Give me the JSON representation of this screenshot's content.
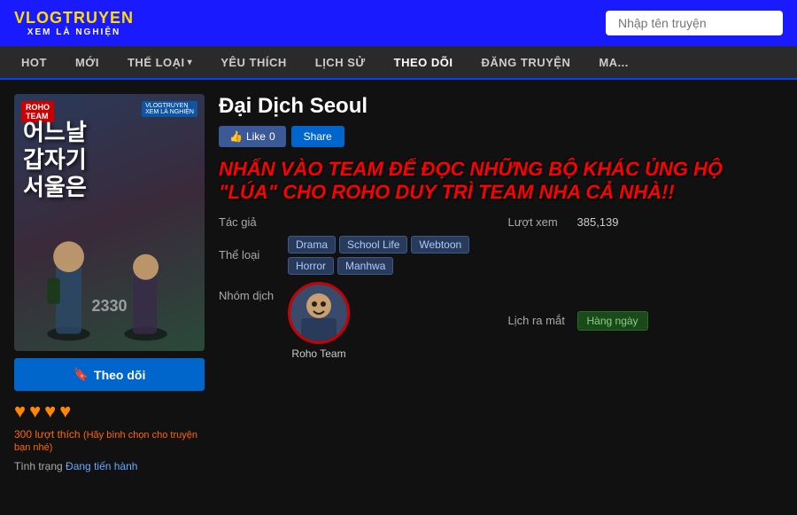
{
  "header": {
    "logo_top": "VLOGTRUYEN",
    "logo_sub": "XEM LÀ NGHIỆN",
    "search_placeholder": "Nhập tên truyện"
  },
  "nav": {
    "items": [
      {
        "label": "HOT",
        "has_arrow": false
      },
      {
        "label": "MỚI",
        "has_arrow": false
      },
      {
        "label": "THỂ LOẠI",
        "has_arrow": true
      },
      {
        "label": "YÊU THÍCH",
        "has_arrow": false
      },
      {
        "label": "LỊCH SỬ",
        "has_arrow": false
      },
      {
        "label": "THEO DÕI",
        "has_arrow": false
      },
      {
        "label": "ĐĂNG TRUYỆN",
        "has_arrow": false
      },
      {
        "label": "MA...",
        "has_arrow": false
      }
    ]
  },
  "manga": {
    "cover_title_kr": "어느날\n갑자기\n서울은",
    "cover_badge": "ROHO\nTEAM",
    "cover_number": "2330",
    "title": "Đại Dịch Seoul",
    "like_count": "0",
    "share_label": "Share",
    "like_label": "Like",
    "promo_text": "NHẤN VÀO TEAM ĐỂ ĐỌC NHỮNG BỘ KHÁC ỦNG HỘ \"LÚA\" CHO ROHO DUY TRÌ TEAM NHA CẢ NHÀ!!",
    "tac_gia_label": "Tác giả",
    "tac_gia_value": "",
    "luot_xem_label": "Lượt xem",
    "luot_xem_value": "385,139",
    "the_loai_label": "Thể loại",
    "genres": [
      "Drama",
      "School Life",
      "Webtoon",
      "Horror",
      "Manhwa"
    ],
    "nhom_dich_label": "Nhóm dịch",
    "group_name": "Roho Team",
    "lich_ra_mat_label": "Lịch ra mắt",
    "release_value": "Hàng ngày",
    "follow_btn": "Theo dõi",
    "hearts": [
      "♥",
      "♥",
      "♥",
      "♥"
    ],
    "like_count_display": "300 lượt thích",
    "like_vote_prompt": "(Hãy bình chọn cho truyện bạn nhé)",
    "tinh_trang_label": "Tình trạng",
    "tinh_trang_value": "Đang tiến hành"
  }
}
